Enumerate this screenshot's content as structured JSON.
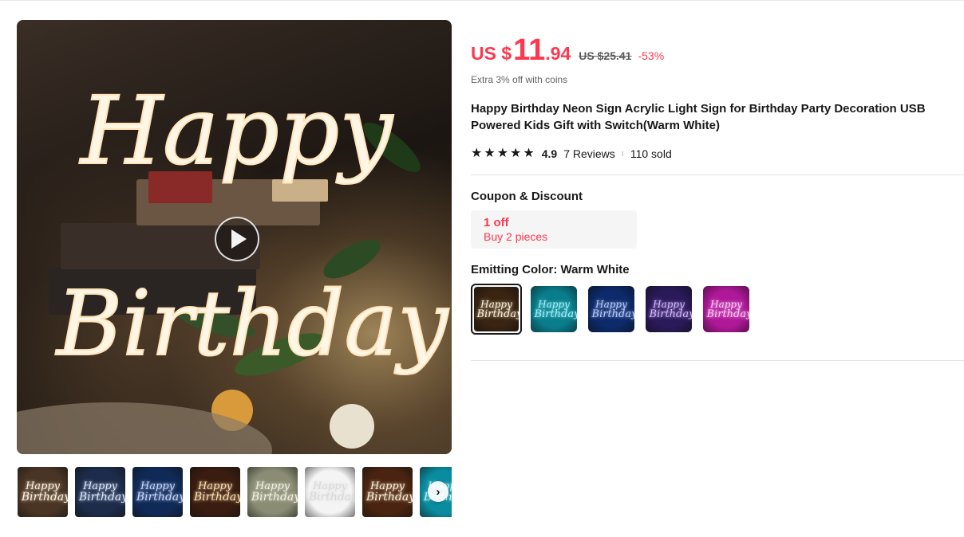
{
  "price": {
    "currency": "US $",
    "integer": "11",
    "decimal": ".94",
    "original": "US $25.41",
    "discount": "-53%"
  },
  "coins_note": "Extra 3% off with coins",
  "product_title": "Happy Birthday Neon Sign Acrylic Light Sign for Birthday Party Decoration USB Powered Kids Gift with Switch(Warm White)",
  "rating": {
    "score": "4.9",
    "stars": 5,
    "reviews": "7 Reviews",
    "separator": "ı",
    "sold": "110 sold"
  },
  "coupon": {
    "section_title": "Coupon & Discount",
    "amount": "1 off",
    "condition": "Buy 2 pieces"
  },
  "color": {
    "label": "Emitting Color: Warm White",
    "options": [
      {
        "name": "Warm White",
        "selected": true,
        "glow": "#fff2d8",
        "bg": "#3a2412"
      },
      {
        "name": "Ice Blue",
        "selected": false,
        "glow": "#9ff6ff",
        "bg": "#0a7d8c"
      },
      {
        "name": "Blue",
        "selected": false,
        "glow": "#b8ccff",
        "bg": "#0d2a6a"
      },
      {
        "name": "Purple",
        "selected": false,
        "glow": "#d3b6ff",
        "bg": "#2a1a5a"
      },
      {
        "name": "Pink",
        "selected": false,
        "glow": "#ffd0f6",
        "bg": "#b0189a"
      }
    ],
    "swatch_text": [
      "Happy",
      "Birthday"
    ]
  },
  "gallery": {
    "main_sign_text": [
      "Happy",
      "Birthday"
    ],
    "thumbnails": [
      {
        "glow": "#fff4e0",
        "bg": "#4a3524"
      },
      {
        "glow": "#dde8ff",
        "bg": "#1c2c4a"
      },
      {
        "glow": "#c8d8ff",
        "bg": "#102a58"
      },
      {
        "glow": "#ffe0b0",
        "bg": "#3a1c10"
      },
      {
        "glow": "#f4f0e4",
        "bg": "#8a8d74"
      },
      {
        "glow": "#d8d8d8",
        "bg": "#f4f4f4"
      },
      {
        "glow": "#fff0d8",
        "bg": "#4a2410"
      },
      {
        "glow": "#b8f6ff",
        "bg": "#0a8ca0"
      }
    ],
    "next_arrow": "›"
  },
  "icons": {
    "play": "play-icon",
    "star": "star-icon",
    "chevron": "chevron-right-icon"
  },
  "colors": {
    "accent_red": "#fd384f",
    "text_dark": "#191919",
    "text_muted": "#666666"
  }
}
